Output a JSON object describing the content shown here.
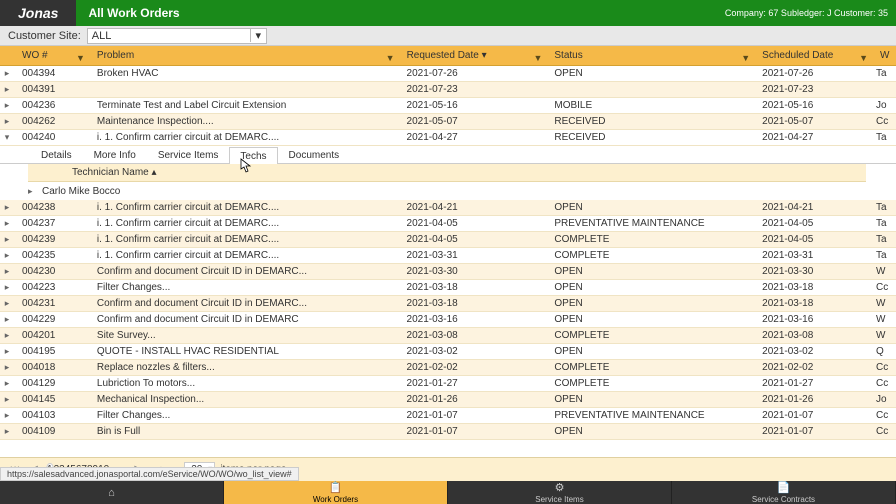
{
  "top": {
    "brand": "Jonas",
    "title": "All Work Orders",
    "right": "Company: 67   Subledger: J   Customer: 35"
  },
  "cust": {
    "label": "Customer Site:",
    "value": "ALL"
  },
  "cols": {
    "wo": "WO #",
    "prob": "Problem",
    "req": "Requested Date ▾",
    "stat": "Status",
    "sched": "Scheduled Date",
    "last": "W"
  },
  "rows_top": [
    {
      "wo": "004394",
      "prob": "Broken HVAC",
      "req": "2021-07-26",
      "stat": "OPEN",
      "sched": "2021-07-26",
      "last": "Ta"
    },
    {
      "wo": "004391",
      "prob": "",
      "req": "2021-07-23",
      "stat": "",
      "sched": "2021-07-23",
      "last": ""
    },
    {
      "wo": "004236",
      "prob": "Terminate Test and Label Circuit Extension",
      "req": "2021-05-16",
      "stat": "MOBILE",
      "sched": "2021-05-16",
      "last": "Jo"
    },
    {
      "wo": "004262",
      "prob": "Maintenance Inspection....",
      "req": "2021-05-07",
      "stat": "RECEIVED",
      "sched": "2021-05-07",
      "last": "Cc"
    },
    {
      "wo": "004240",
      "prob": "i. 1. Confirm carrier circuit at DEMARC....",
      "req": "2021-04-27",
      "stat": "RECEIVED",
      "sched": "2021-04-27",
      "last": "Ta",
      "exp": true
    }
  ],
  "tabs": [
    "Details",
    "More Info",
    "Service Items",
    "Techs",
    "Documents"
  ],
  "tech_hdr": "Technician Name ▴",
  "tech_name": "Carlo Mike Bocco",
  "rows_bot": [
    {
      "wo": "004238",
      "prob": "i. 1. Confirm carrier circuit at DEMARC....",
      "req": "2021-04-21",
      "stat": "OPEN",
      "sched": "2021-04-21",
      "last": "Ta"
    },
    {
      "wo": "004237",
      "prob": "i. 1. Confirm carrier circuit at DEMARC....",
      "req": "2021-04-05",
      "stat": "PREVENTATIVE MAINTENANCE",
      "sched": "2021-04-05",
      "last": "Ta"
    },
    {
      "wo": "004239",
      "prob": "i. 1. Confirm carrier circuit at DEMARC....",
      "req": "2021-04-05",
      "stat": "COMPLETE",
      "sched": "2021-04-05",
      "last": "Ta"
    },
    {
      "wo": "004235",
      "prob": "i. 1. Confirm carrier circuit at DEMARC....",
      "req": "2021-03-31",
      "stat": "COMPLETE",
      "sched": "2021-03-31",
      "last": "Ta"
    },
    {
      "wo": "004230",
      "prob": "Confirm and document Circuit ID in DEMARC...",
      "req": "2021-03-30",
      "stat": "OPEN",
      "sched": "2021-03-30",
      "last": "W"
    },
    {
      "wo": "004223",
      "prob": "Filter Changes...",
      "req": "2021-03-18",
      "stat": "OPEN",
      "sched": "2021-03-18",
      "last": "Cc"
    },
    {
      "wo": "004231",
      "prob": "Confirm and document Circuit ID in DEMARC...",
      "req": "2021-03-18",
      "stat": "OPEN",
      "sched": "2021-03-18",
      "last": "W"
    },
    {
      "wo": "004229",
      "prob": "Confirm and document Circuit ID in DEMARC",
      "req": "2021-03-16",
      "stat": "OPEN",
      "sched": "2021-03-16",
      "last": "W"
    },
    {
      "wo": "004201",
      "prob": "Site Survey...",
      "req": "2021-03-08",
      "stat": "COMPLETE",
      "sched": "2021-03-08",
      "last": "W"
    },
    {
      "wo": "004195",
      "prob": "QUOTE - INSTALL HVAC RESIDENTIAL",
      "req": "2021-03-02",
      "stat": "OPEN",
      "sched": "2021-03-02",
      "last": "Q"
    },
    {
      "wo": "004018",
      "prob": "Replace nozzles & filters...",
      "req": "2021-02-02",
      "stat": "COMPLETE",
      "sched": "2021-02-02",
      "last": "Cc"
    },
    {
      "wo": "004129",
      "prob": "Lubriction To motors...",
      "req": "2021-01-27",
      "stat": "COMPLETE",
      "sched": "2021-01-27",
      "last": "Cc"
    },
    {
      "wo": "004145",
      "prob": "Mechanical Inspection...",
      "req": "2021-01-26",
      "stat": "OPEN",
      "sched": "2021-01-26",
      "last": "Jo"
    },
    {
      "wo": "004103",
      "prob": "Filter Changes...",
      "req": "2021-01-07",
      "stat": "PREVENTATIVE MAINTENANCE",
      "sched": "2021-01-07",
      "last": "Cc"
    },
    {
      "wo": "004109",
      "prob": "Bin is Full",
      "req": "2021-01-07",
      "stat": "OPEN",
      "sched": "2021-01-07",
      "last": "Cc"
    }
  ],
  "pager": {
    "pages": [
      "1",
      "2",
      "3",
      "4",
      "5",
      "6",
      "7",
      "8",
      "9",
      "10"
    ],
    "more": "...",
    "ipp": "20",
    "ipp_lbl": "items per page"
  },
  "bottom": [
    "",
    "Work Orders",
    "Service Items",
    "Service Contracts"
  ],
  "url": "https://salesadvanced.jonasportal.com/eService/WO/WO/wo_list_view#"
}
